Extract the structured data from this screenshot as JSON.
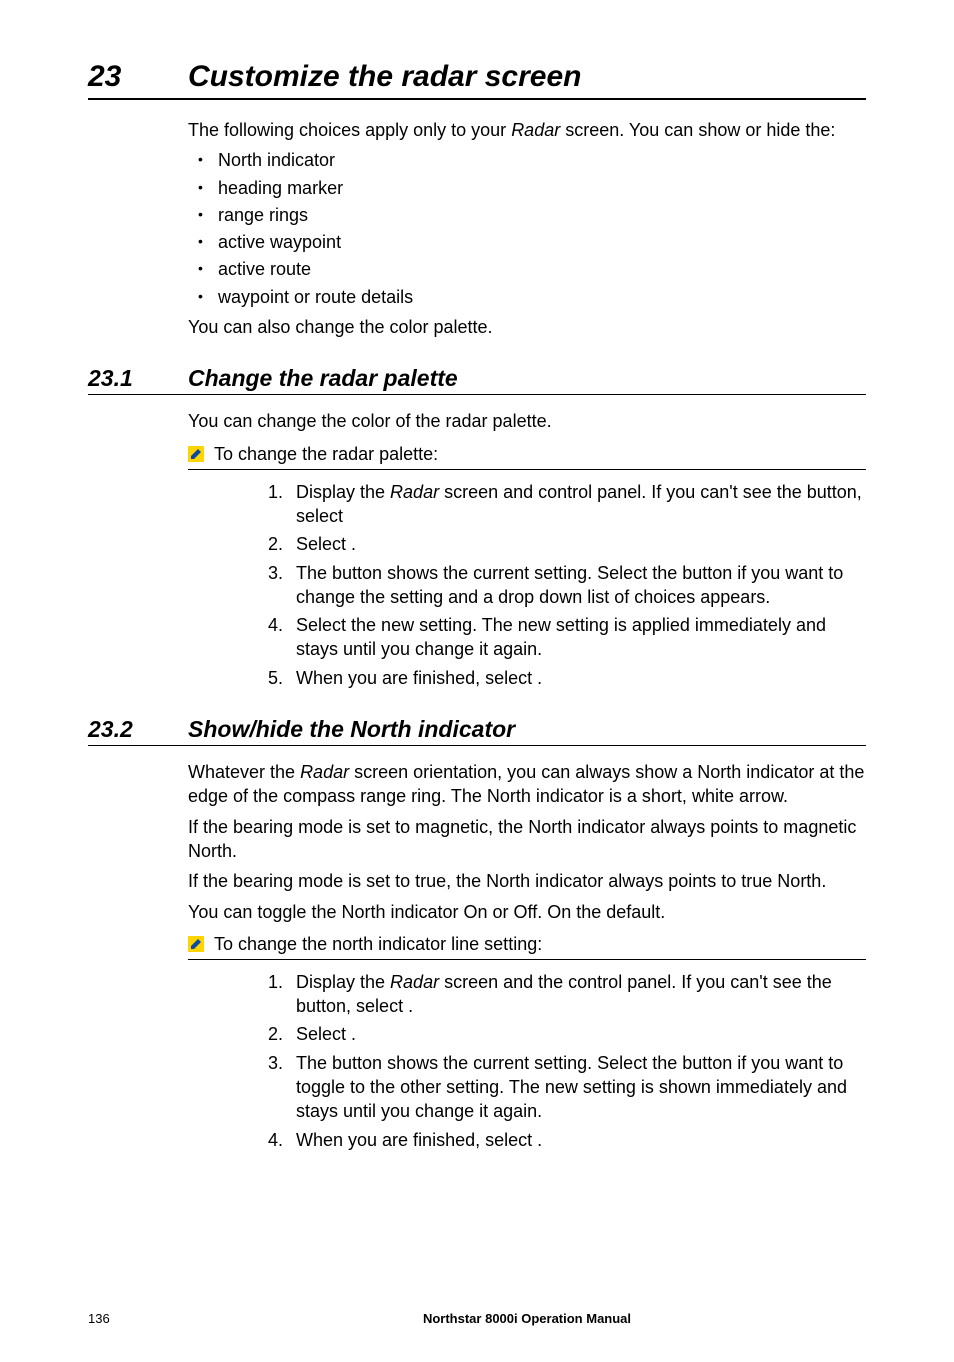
{
  "chapter": {
    "number": "23",
    "title": "Customize the radar screen"
  },
  "intro": {
    "lead_pre": "The following choices apply only to your ",
    "lead_em": "Radar",
    "lead_post": " screen. You can show or hide the:",
    "bullets": [
      "North indicator",
      "heading marker",
      "range rings",
      "active waypoint",
      "active route",
      "waypoint or route details"
    ],
    "tail": "You can also change the color palette."
  },
  "s1": {
    "number": "23.1",
    "title": "Change the radar palette",
    "para": "You can change the color of the radar palette.",
    "proc_label": "To change the radar palette:",
    "step1_pre": "Display the ",
    "step1_em": "Radar",
    "step1_post": " screen and control panel. If you can't see the             button, select",
    "step2": "Select                               .",
    "step3": "The               button shows the current setting. Select the button if you want to change the setting and a drop down list of choices appears.",
    "step4": "Select the new setting. The new setting is applied immediately and stays until you change it again.",
    "step5": "When you are finished, select                 ."
  },
  "s2": {
    "number": "23.2",
    "title": "Show/hide the North indicator",
    "p1_pre": "Whatever the ",
    "p1_em": "Radar",
    "p1_post": " screen orientation, you can always show a North indicator at the edge of the compass range ring. The North indicator is a short, white arrow.",
    "p2": "If the bearing mode is set to magnetic, the North indicator always points to magnetic North.",
    "p3": "If the bearing mode is set to true, the North indicator always points to true North.",
    "p4": "You can toggle the North indicator On or Off. On the default.",
    "proc_label": "To change the north indicator line setting:",
    "step1_pre": "Display the ",
    "step1_em": "Radar",
    "step1_post": " screen and the control panel. If you can't see the                         button, select                 .",
    "step2": "Select                                         .",
    "step3": "The                                               button shows the current setting. Select the button if you want to toggle to the other setting. The new setting is shown immediately and stays until you change it again.",
    "step4": "When you are finished, select                 ."
  },
  "footer": {
    "page": "136",
    "title": "Northstar 8000i Operation Manual"
  }
}
